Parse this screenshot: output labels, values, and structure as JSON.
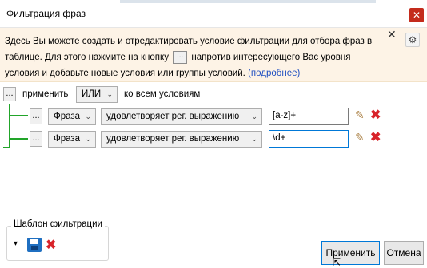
{
  "window": {
    "title": "Фильтрация фраз",
    "close_icon": "✕"
  },
  "info": {
    "text_part1": "Здесь Вы можете создать и отредактировать условие фильтрации для отбора фраз в таблице. Для этого нажмите на кнопку",
    "inline_button": "...",
    "text_part2": "напротив интересующего Вас уровня условия и добавьте новые условия или группы условий.",
    "link": "(подробнее)",
    "close_icon": "✕",
    "settings_icon": "⚙"
  },
  "header_row": {
    "dots": "...",
    "apply_label": "применить",
    "operator": "ИЛИ",
    "suffix": "ко всем условиям"
  },
  "conditions": [
    {
      "dots": "...",
      "field": "Фраза",
      "operator": "удовлетворяет рег. выражению",
      "value": "[a-z]+"
    },
    {
      "dots": "...",
      "field": "Фраза",
      "operator": "удовлетворяет рег. выражению",
      "value": "\\d+"
    }
  ],
  "template": {
    "label": "Шаблон фильтрации",
    "dropdown_icon": "▾",
    "save_icon": "💾",
    "delete_icon": "✖"
  },
  "buttons": {
    "apply": "Применить",
    "cancel": "Отмена"
  }
}
